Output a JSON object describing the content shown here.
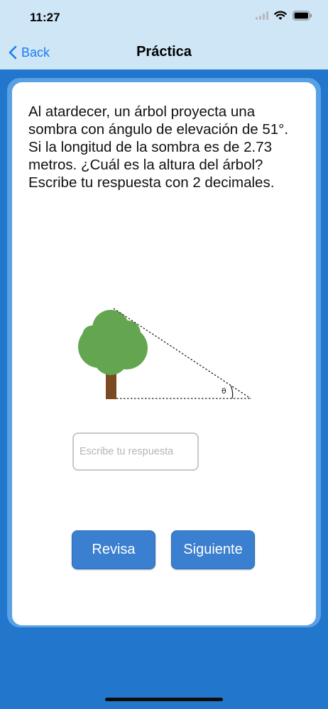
{
  "status_bar": {
    "time": "11:27"
  },
  "nav": {
    "back_label": "Back",
    "title": "Práctica"
  },
  "question": {
    "text": "Al atardecer, un árbol proyecta una sombra con ángulo de elevación de 51°. Si la longitud de la sombra es de 2.73 metros. ¿Cuál es la altura del árbol? Escribe tu respuesta con 2 decimales."
  },
  "diagram": {
    "angle_label": "θ"
  },
  "answer": {
    "value": "",
    "placeholder": "Escribe tu respuesta"
  },
  "buttons": {
    "check_label": "Revisa",
    "next_label": "Siguiente"
  },
  "colors": {
    "background": "#2277cc",
    "header": "#cfe6f7",
    "button": "#3a7fd0",
    "link": "#1a7cf0",
    "tree_foliage": "#63a64f",
    "tree_trunk": "#7a4a22"
  }
}
